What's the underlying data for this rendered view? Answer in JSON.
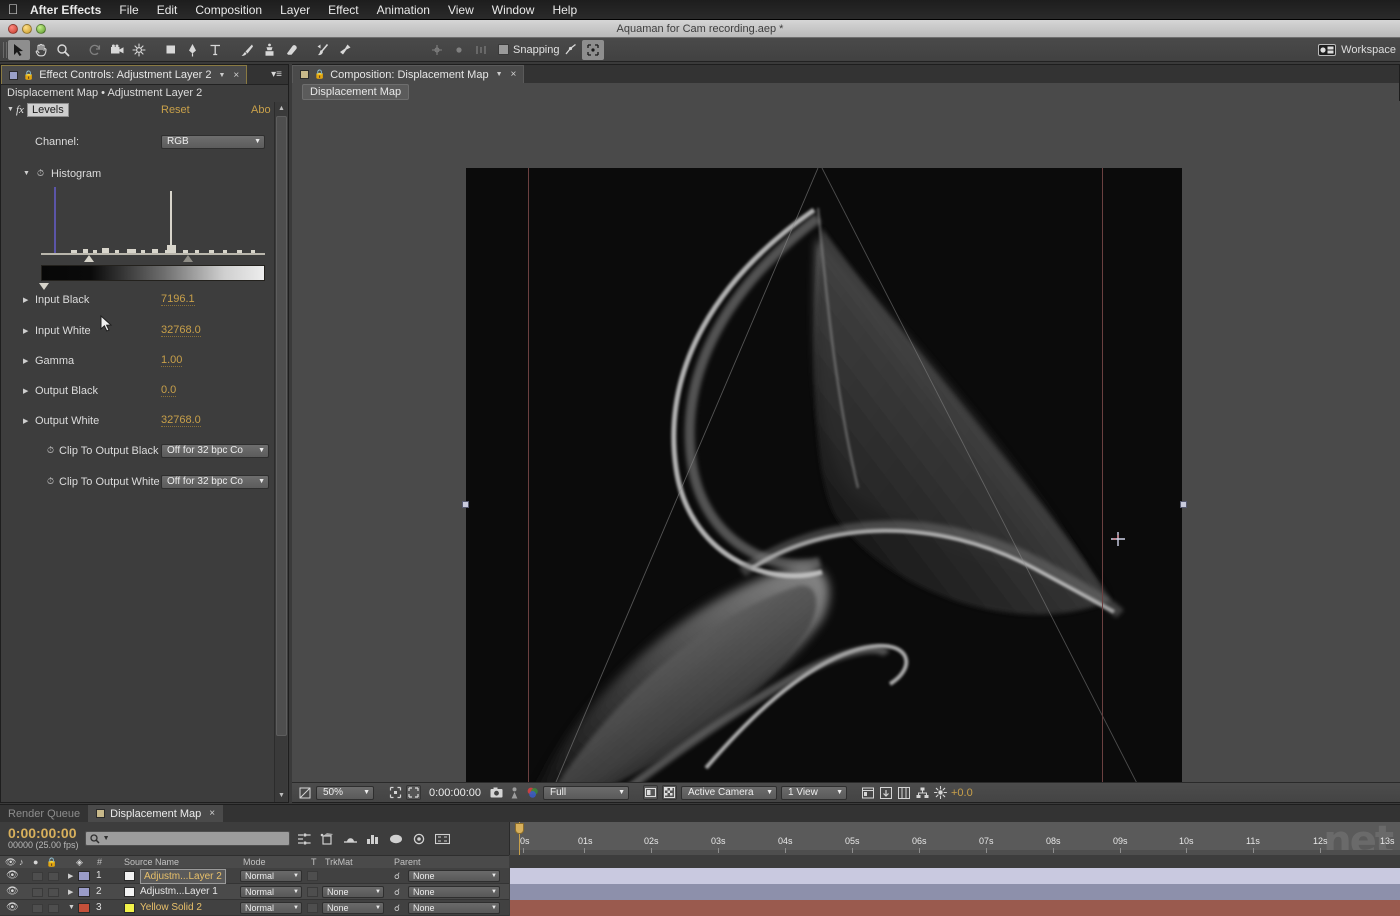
{
  "os_menu": {
    "apple_icon": "apple-logo-icon",
    "items": [
      {
        "label": "After Effects",
        "bold": true
      },
      {
        "label": "File"
      },
      {
        "label": "Edit"
      },
      {
        "label": "Composition"
      },
      {
        "label": "Layer"
      },
      {
        "label": "Effect"
      },
      {
        "label": "Animation"
      },
      {
        "label": "View"
      },
      {
        "label": "Window"
      },
      {
        "label": "Help"
      }
    ]
  },
  "titlebar": {
    "title": "Aquaman for Cam recording.aep *"
  },
  "toolbar": {
    "snapping_label": "Snapping",
    "workspace_label": "Workspace",
    "tools": [
      {
        "name": "selection-tool-icon",
        "active": true
      },
      {
        "name": "hand-tool-icon",
        "active": false
      },
      {
        "name": "zoom-tool-icon",
        "active": false
      },
      {
        "name": "rotation-tool-icon",
        "active": false,
        "dim": true
      },
      {
        "name": "camera-tool-icon",
        "active": false
      },
      {
        "name": "pan-behind-tool-icon",
        "active": false
      },
      {
        "name": "shape-tool-icon",
        "active": false
      },
      {
        "name": "pen-tool-icon",
        "active": false
      },
      {
        "name": "type-tool-icon",
        "active": false
      },
      {
        "name": "brush-tool-icon",
        "active": false
      },
      {
        "name": "clone-stamp-tool-icon",
        "active": false
      },
      {
        "name": "eraser-tool-icon",
        "active": false
      },
      {
        "name": "roto-brush-tool-icon",
        "active": false
      },
      {
        "name": "puppet-pin-tool-icon",
        "active": false
      }
    ]
  },
  "effect_controls": {
    "tab_title": "Effect Controls: Adjustment Layer 2",
    "subtitle": "Displacement Map • Adjustment Layer 2",
    "effect_name": "Levels",
    "fx_label": "fx",
    "reset_label": "Reset",
    "about_label": "Abo",
    "channel_label": "Channel:",
    "channel_value": "RGB",
    "histogram_label": "Histogram",
    "params": [
      {
        "name": "Input Black",
        "value": "7196.1"
      },
      {
        "name": "Input White",
        "value": "32768.0"
      },
      {
        "name": "Gamma",
        "value": "1.00"
      },
      {
        "name": "Output Black",
        "value": "0.0"
      },
      {
        "name": "Output White",
        "value": "32768.0"
      }
    ],
    "clip_params": [
      {
        "name": "Clip To Output Black",
        "value": "Off for 32 bpc Co"
      },
      {
        "name": "Clip To Output White",
        "value": "Off for 32 bpc Co"
      }
    ]
  },
  "composition": {
    "tab_title": "Composition: Displacement Map",
    "breadcrumb": "Displacement Map",
    "viewer_toolbar": {
      "magnification": "50%",
      "timecode": "0:00:00:00",
      "resolution": "Full",
      "camera": "Active Camera",
      "views": "1 View",
      "exposure": "+0.0"
    }
  },
  "timeline": {
    "tabs": [
      {
        "label": "Render Queue",
        "active": false
      },
      {
        "label": "Displacement Map",
        "active": true
      }
    ],
    "timecode": "0:00:00:00",
    "frames": "00000 (25.00 fps)",
    "search_placeholder": "",
    "columns": [
      "#",
      "Source Name",
      "Mode",
      "T",
      "TrkMat",
      "Parent"
    ],
    "ruler_ticks": [
      "0s",
      "01s",
      "02s",
      "03s",
      "04s",
      "05s",
      "06s",
      "07s",
      "08s",
      "09s",
      "10s",
      "11s",
      "12s",
      "13s"
    ],
    "watermark": "net",
    "layers": [
      {
        "index": "1",
        "name": "Adjustm...Layer 2",
        "mode": "Normal",
        "trkmat": "",
        "parent": "None",
        "color": "#9a9cc8",
        "swatch": "#f2f2f2",
        "bar": "#c9c9e0",
        "selected": true,
        "twirl": "right"
      },
      {
        "index": "2",
        "name": "Adjustm...Layer 1",
        "mode": "Normal",
        "trkmat": "None",
        "parent": "None",
        "color": "#9a9cc8",
        "swatch": "#f2f2f2",
        "bar": "#8d90ab",
        "selected": false,
        "twirl": "right"
      },
      {
        "index": "3",
        "name": "Yellow Solid 2",
        "mode": "Normal",
        "trkmat": "None",
        "parent": "None",
        "color": "#c4503a",
        "swatch": "#f2f24a",
        "bar": "#9a5a4e",
        "selected": false,
        "twirl": "down"
      }
    ]
  },
  "colors": {
    "accent_gold": "#c8a04a",
    "panel_bg": "#3d3d3d",
    "canvas_bg": "#0b0b0b",
    "guide_red": "#6b4040"
  }
}
